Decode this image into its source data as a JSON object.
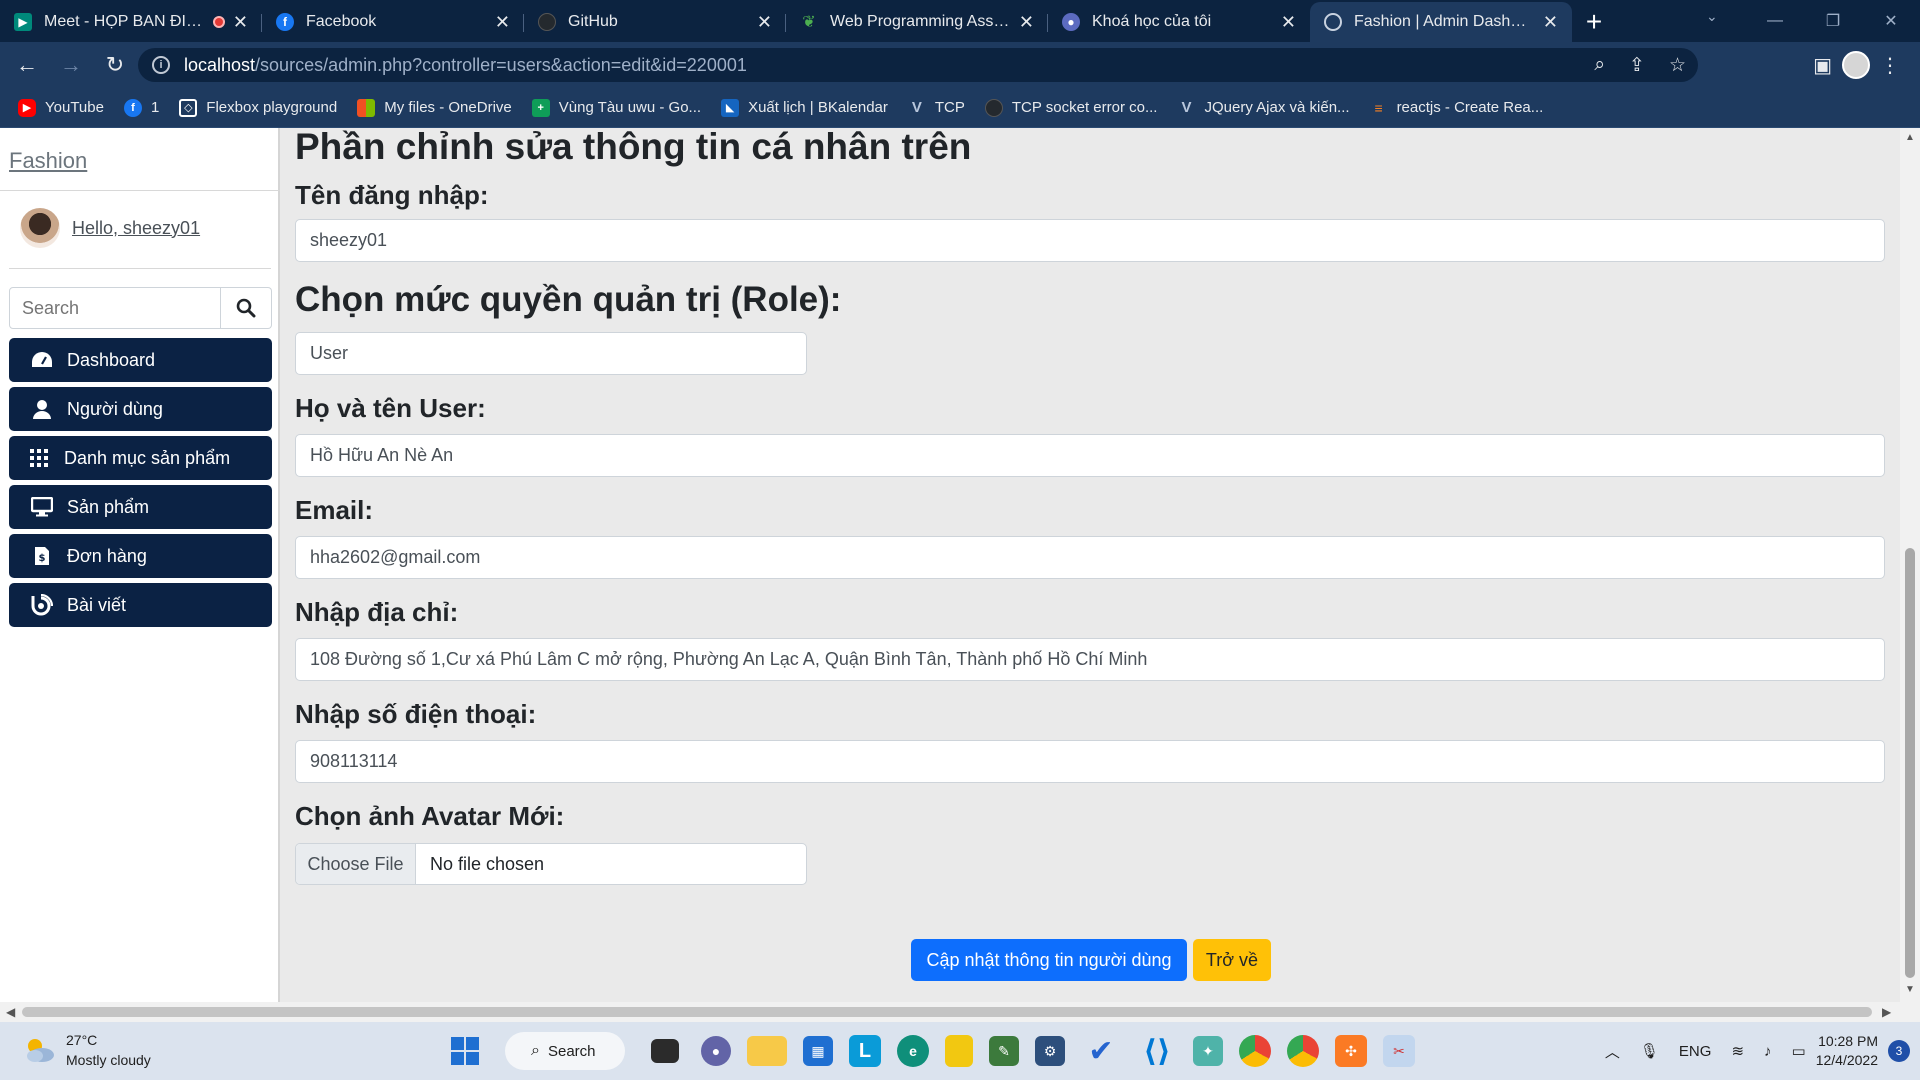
{
  "browser": {
    "tabs": [
      {
        "title": "Meet - HỌP BAN ĐIỀU",
        "icon": "meet-icon",
        "color": "#00897b",
        "recording": true
      },
      {
        "title": "Facebook",
        "icon": "facebook-icon",
        "color": "#1877f2"
      },
      {
        "title": "GitHub",
        "icon": "github-icon",
        "color": "#24292e"
      },
      {
        "title": "Web Programming Assignme",
        "icon": "leaf-icon",
        "color": "#2e7d32"
      },
      {
        "title": "Khoá học của tôi",
        "icon": "course-icon",
        "color": "#5c6bc0"
      },
      {
        "title": "Fashion | Admin Dashboard",
        "icon": "globe-icon",
        "color": "#9fb0c8",
        "active": true
      }
    ],
    "new_tab": "+",
    "url_host": "localhost",
    "url_path": "/sources/admin.php?controller=users&action=edit&id=220001",
    "bookmarks": [
      {
        "label": "YouTube",
        "icon": "youtube-icon",
        "color": "#ff0000"
      },
      {
        "label": "1",
        "icon": "facebook-icon",
        "color": "#1877f2"
      },
      {
        "label": "Flexbox playground",
        "icon": "flexbox-icon",
        "color": "#ffffff"
      },
      {
        "label": "My files - OneDrive",
        "icon": "microsoft-icon",
        "color": "#f25022"
      },
      {
        "label": "Vùng Tàu uwu - Go...",
        "icon": "sheets-icon",
        "color": "#0f9d58"
      },
      {
        "label": "Xuất lịch | BKalendar",
        "icon": "bkalendar-icon",
        "color": "#1565c0"
      },
      {
        "label": "TCP",
        "icon": "v-icon",
        "color": "#8aa0c0"
      },
      {
        "label": "TCP socket error co...",
        "icon": "github-icon",
        "color": "#24292e"
      },
      {
        "label": "JQuery Ajax và kiến...",
        "icon": "v-icon",
        "color": "#8aa0c0"
      },
      {
        "label": "reactjs - Create Rea...",
        "icon": "stackoverflow-icon",
        "color": "#f48024"
      }
    ]
  },
  "sidebar": {
    "brand": "Fashion",
    "hello": "Hello, sheezy01",
    "search_placeholder": "Search",
    "items": [
      {
        "label": "Dashboard",
        "icon": "dashboard-icon"
      },
      {
        "label": "Người dùng",
        "icon": "user-icon"
      },
      {
        "label": "Danh mục sản phẩm",
        "icon": "grid-icon"
      },
      {
        "label": "Sản phẩm",
        "icon": "monitor-icon"
      },
      {
        "label": "Đơn hàng",
        "icon": "invoice-icon"
      },
      {
        "label": "Bài viết",
        "icon": "blog-icon"
      }
    ]
  },
  "form": {
    "title": "Phần chỉnh sửa thông tin cá nhân trên",
    "username_label": "Tên đăng nhập:",
    "username_value": "sheezy01",
    "role_label": "Chọn mức quyền quản trị (Role):",
    "role_value": "User",
    "fullname_label": "Họ và tên User:",
    "fullname_value": "Hồ Hữu An Nè An",
    "email_label": "Email:",
    "email_value": "hha2602@gmail.com",
    "address_label": "Nhập địa chỉ:",
    "address_value": "108 Đường số 1,Cư xá Phú Lâm C mở rộng, Phường An Lạc A, Quận Bình Tân, Thành phố Hồ Chí Minh",
    "phone_label": "Nhập số điện thoại:",
    "phone_value": "908113114",
    "avatar_label": "Chọn ảnh Avatar Mới:",
    "choose_file": "Choose File",
    "no_file": "No file chosen",
    "submit_label": "Cập nhật thông tin người dùng",
    "back_label": "Trở về",
    "colors": {
      "primary": "#0d6efd",
      "warning": "#ffc107",
      "menu": "#0b2244"
    }
  },
  "taskbar": {
    "temp": "27°C",
    "weather": "Mostly cloudy",
    "search": "Search",
    "lang": "ENG",
    "time": "10:28 PM",
    "date": "12/4/2022",
    "notifications": "3"
  }
}
